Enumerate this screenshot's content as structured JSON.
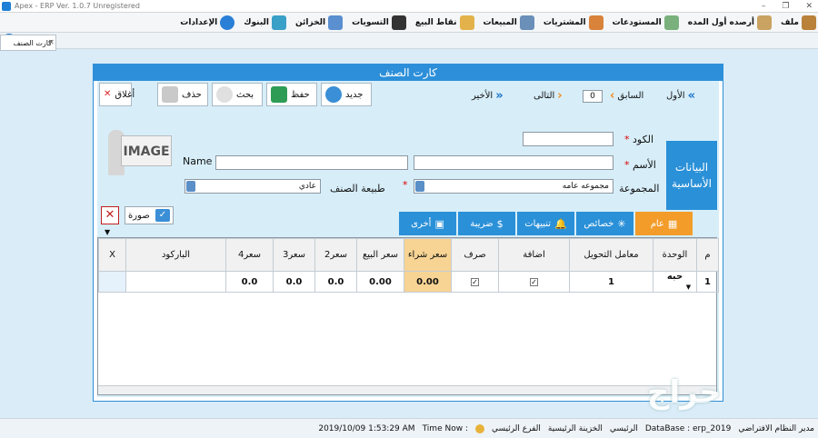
{
  "titlebar": {
    "title": "Apex - ERP Ver. 1.0.7 Unregistered"
  },
  "menu": {
    "items": [
      {
        "label": "ملف",
        "color": "#b9813a"
      },
      {
        "label": "أرصده أول المده",
        "color": "#caa262"
      },
      {
        "label": "المستودعات",
        "color": "#7ab07c"
      },
      {
        "label": "المشتريات",
        "color": "#d9823a"
      },
      {
        "label": "المبيعات",
        "color": "#6a8fb8"
      },
      {
        "label": "نقاط البيع",
        "color": "#e3b24a"
      },
      {
        "label": "التسويات",
        "color": "#333333"
      },
      {
        "label": "الخزائن",
        "color": "#5a8fd0"
      },
      {
        "label": "البنوك",
        "color": "#3aa0c8"
      },
      {
        "label": "الإعدادات",
        "color": "#2a7fd6"
      }
    ]
  },
  "tabstrip": {
    "open_tab": "كارت الصنف"
  },
  "window": {
    "title": "كارت الصنف",
    "toolbar": {
      "first": "الأول",
      "prev": "السابق",
      "page": "0",
      "next": "التالى",
      "last": "الأخير",
      "new": "جديد",
      "save": "حفظ",
      "search": "بحث",
      "delete": "حذف",
      "close": "أغلاق"
    },
    "section_title": "البيانات الأساسية",
    "image_text": "IMAGE",
    "form": {
      "code_label": "الكود",
      "code_value": "",
      "name_label": "الأسم",
      "name_value": "",
      "name_en_label": "Name",
      "name_en_value": "",
      "group_label": "المجموعة",
      "group_value": "مجموعه عامه",
      "nature_label": "طبيعة الصنف",
      "nature_value": "عادي"
    },
    "photo_btn": "صورة",
    "tabs": [
      {
        "label": "عام",
        "icon": "▦"
      },
      {
        "label": "خصائص",
        "icon": "✳"
      },
      {
        "label": "تنبيهات",
        "icon": "🔔"
      },
      {
        "label": "ضريبة",
        "icon": "$"
      },
      {
        "label": "أخرى",
        "icon": "▣"
      }
    ],
    "grid": {
      "headers": [
        "م",
        "الوحدة",
        "معامل التحويل",
        "اضافة",
        "صرف",
        "سعر شراء",
        "سعر البيع",
        "سعر2",
        "سعر3",
        "سعر4",
        "الباركود",
        "X"
      ],
      "row": {
        "index": "1",
        "unit": "حبه",
        "factor": "1",
        "add": "☑",
        "issue": "☑",
        "buy": "0.00",
        "sell": "0.00",
        "p2": "0.0",
        "p3": "0.0",
        "p4": "0.0",
        "barcode": "",
        "x": ""
      }
    }
  },
  "status": {
    "user": "مدير النظام الافتراضي",
    "db_label": "DataBase : erp_2019",
    "branch": "الرئيسي",
    "treasury": "الخزينة الرئيسية",
    "main_branch": "الفرع الرئيسي",
    "time_label": "Time Now :",
    "time_value": "2019/10/09 1:53:29 AM"
  },
  "watermark": "حراج"
}
